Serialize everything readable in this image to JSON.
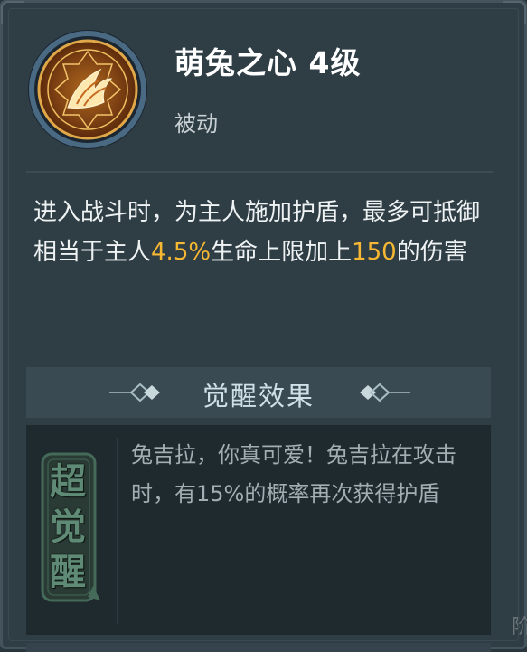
{
  "skill": {
    "icon": "paw-claw-emblem-icon",
    "title": "萌兔之心 4级",
    "type": "被动",
    "description": {
      "part1": "进入战斗时，为主人施加护盾，最多可抵御相当于主人",
      "value1": "4.5%",
      "part2": "生命上限加上",
      "value2": "150",
      "part3": "的伤害"
    }
  },
  "awaken": {
    "header": "觉醒效果",
    "badge_text": "超觉醒",
    "description": "兔吉拉，你真可爱！兔吉拉在攻击时，有15%的概率再次获得护盾"
  },
  "edge_text": "阶",
  "colors": {
    "panel": "#2f3d45",
    "highlight": "#f6b732",
    "title": "#ffffff",
    "awaken_text": "#a2aeb2"
  }
}
